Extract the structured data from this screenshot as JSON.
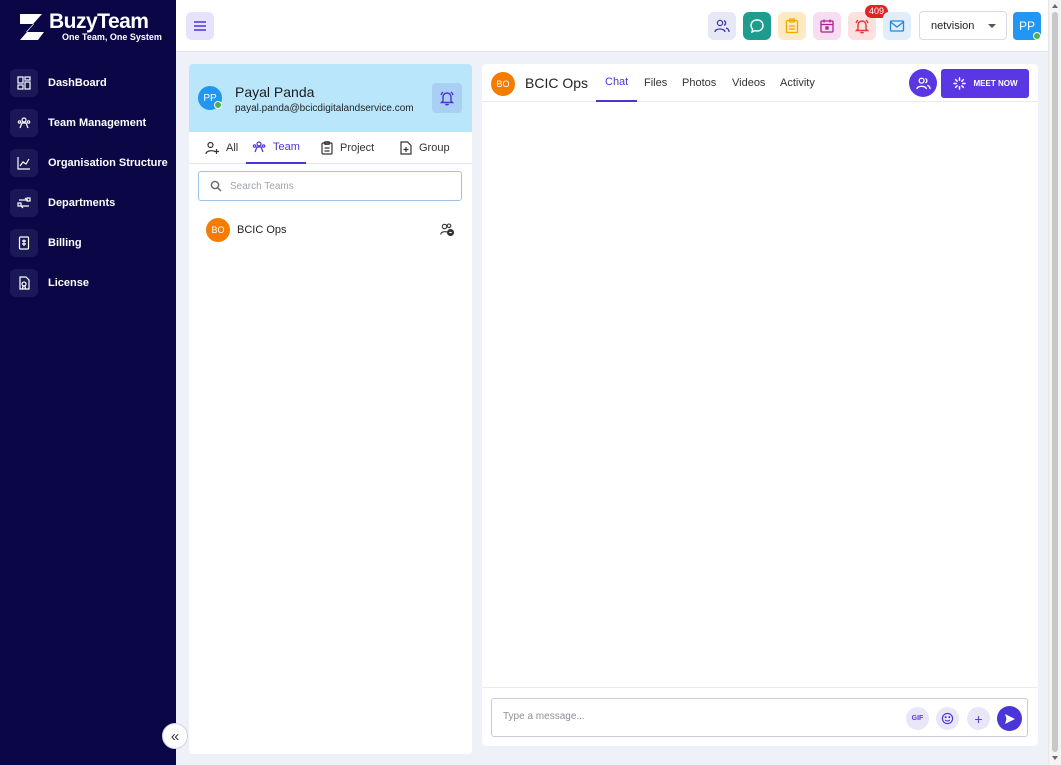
{
  "brand": {
    "name": "BuzyTeam",
    "tagline": "One Team, One System"
  },
  "sidebar": {
    "items": [
      {
        "label": "DashBoard",
        "icon": "dashboard-icon"
      },
      {
        "label": "Team Management",
        "icon": "team-icon"
      },
      {
        "label": "Organisation Structure",
        "icon": "org-chart-icon"
      },
      {
        "label": "Departments",
        "icon": "departments-icon"
      },
      {
        "label": "Billing",
        "icon": "billing-icon"
      },
      {
        "label": "License",
        "icon": "license-icon"
      }
    ],
    "collapse_glyph": "«"
  },
  "topbar": {
    "notification_count": "409",
    "org_name": "netvision",
    "user_initials": "PP",
    "colors": {
      "teams": "#e6e8f7",
      "chat": "#1e9c8e",
      "tasks": "#fde9c4",
      "calendar": "#f7dcf2",
      "alerts": "#fde0e0",
      "mail": "#e0eefb"
    }
  },
  "profile": {
    "initials": "PP",
    "name": "Payal Panda",
    "email": "payal.panda@bcicdigitalandservice.com"
  },
  "filters": {
    "tabs": [
      {
        "label": "All",
        "icon": "add-person-icon"
      },
      {
        "label": "Team",
        "icon": "team-icon"
      },
      {
        "label": "Project",
        "icon": "clipboard-icon"
      },
      {
        "label": "Group",
        "icon": "add-file-icon"
      }
    ],
    "active": "Team"
  },
  "search": {
    "placeholder": "Search Teams",
    "value": ""
  },
  "teams": [
    {
      "initials": "BO",
      "name": "BCIC Ops"
    }
  ],
  "chat": {
    "initials": "BO",
    "title": "BCIC Ops",
    "tabs": [
      "Chat",
      "Files",
      "Photos",
      "Videos",
      "Activity"
    ],
    "active_tab": "Chat",
    "meet_label": "MEET NOW",
    "composer_placeholder": "Type a message...",
    "composer_value": "",
    "gif_label": "GIF",
    "add_glyph": "+"
  },
  "accent_color": "#5b36e3"
}
